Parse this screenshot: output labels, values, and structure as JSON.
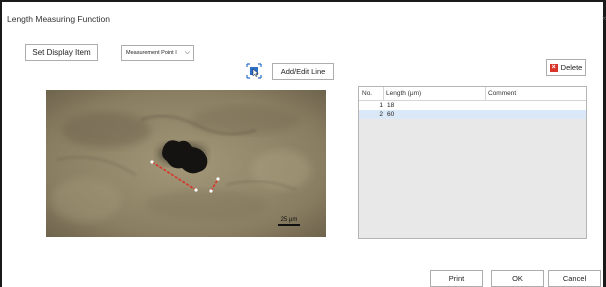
{
  "window": {
    "title": "Length Measuring Function",
    "close_glyph": "×"
  },
  "toolbar": {
    "set_display_label": "Set Display Item",
    "measurement_select_value": "Measurement Point I",
    "add_edit_label": "Add/Edit Line",
    "delete_label": "Delete",
    "select_icon": "selection-arrow-icon"
  },
  "image": {
    "scale_label": "25 μm",
    "line_color": "#d9342b"
  },
  "table": {
    "columns": [
      "No.",
      "Length (μm)",
      "Comment"
    ],
    "rows": [
      {
        "no": "1",
        "length": "18",
        "comment": ""
      },
      {
        "no": "2",
        "length": "60",
        "comment": ""
      }
    ],
    "selected_row_color": "#dbe8f7"
  },
  "footer": {
    "print_label": "Print",
    "ok_label": "OK",
    "cancel_label": "Cancel"
  }
}
